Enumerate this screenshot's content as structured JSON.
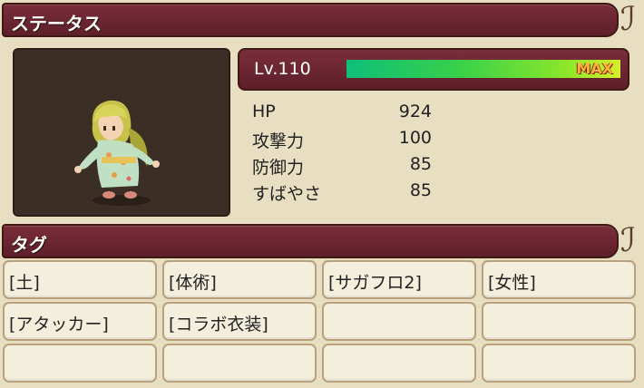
{
  "status_header": {
    "title": "ステータス"
  },
  "level": {
    "label": "Lv.110",
    "max_label": "MAX",
    "progress": 1.0
  },
  "stats": [
    {
      "name": "HP",
      "value": "924"
    },
    {
      "name": "攻撃力",
      "value": "100"
    },
    {
      "name": "防御力",
      "value": "85"
    },
    {
      "name": "すばやさ",
      "value": "85"
    }
  ],
  "tag_header": {
    "title": "タグ"
  },
  "tags": [
    "[土]",
    "[体術]",
    "[サガフロ2]",
    "[女性]",
    "[アタッカー]",
    "[コラボ衣装]",
    "",
    "",
    "",
    "",
    "",
    ""
  ],
  "colors": {
    "header": "#6b2633",
    "panel": "#e8dfc2",
    "portrait_bg": "#3b2e25",
    "exp_bar_start": "#0fbf7a",
    "exp_bar_end": "#d6ef2a",
    "max_text": "#ffb340"
  },
  "icons": {
    "header_ornament": "scroll-curl-icon",
    "character": "character-sprite"
  }
}
